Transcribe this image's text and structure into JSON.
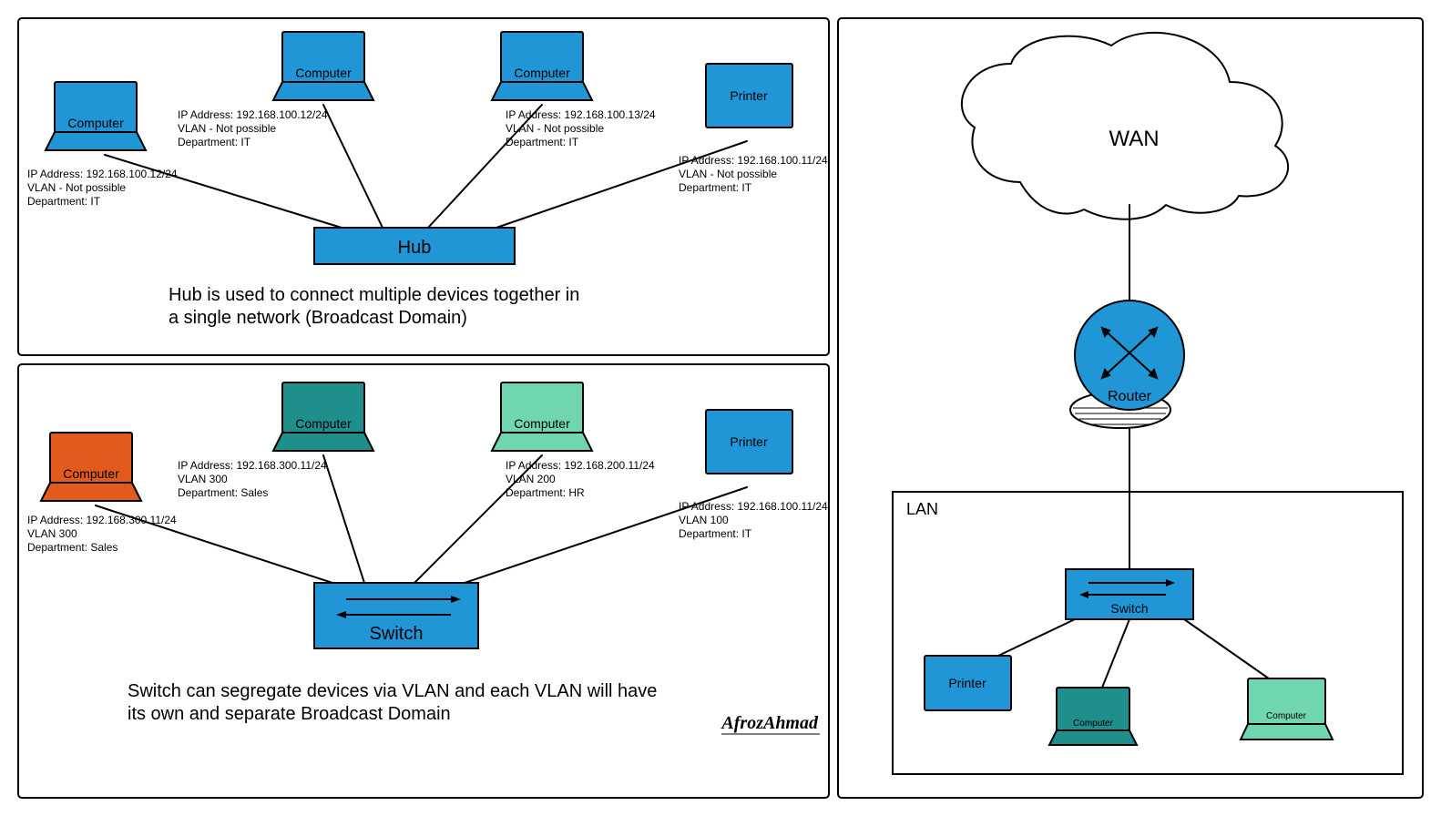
{
  "author": "AfrozAhmad",
  "colors": {
    "blue": "#2196d6",
    "teal": "#1f8f8c",
    "mint": "#6fd6b0",
    "orange": "#e35b1c"
  },
  "panel1": {
    "hub_label": "Hub",
    "caption_line1": "Hub is used to connect multiple devices together in",
    "caption_line2": "a single network (Broadcast Domain)",
    "nodes": [
      {
        "kind": "computer",
        "label": "Computer",
        "ip": "IP Address: 192.168.100.12/24",
        "vlan": "VLAN - Not possible",
        "dept": "Department: IT"
      },
      {
        "kind": "computer",
        "label": "Computer",
        "ip": "IP Address: 192.168.100.12/24",
        "vlan": "VLAN - Not possible",
        "dept": "Department: IT"
      },
      {
        "kind": "computer",
        "label": "Computer",
        "ip": "IP Address: 192.168.100.13/24",
        "vlan": "VLAN - Not possible",
        "dept": "Department: IT"
      },
      {
        "kind": "printer",
        "label": "Printer",
        "ip": "IP Address: 192.168.100.11/24",
        "vlan": "VLAN - Not possible",
        "dept": "Department: IT"
      }
    ]
  },
  "panel2": {
    "switch_label": "Switch",
    "caption_line1": "Switch can segregate devices via VLAN and each VLAN will have",
    "caption_line2": "its own and separate Broadcast Domain",
    "nodes": [
      {
        "kind": "computer",
        "label": "Computer",
        "ip": "IP Address: 192.168.300.11/24",
        "vlan": "VLAN 300",
        "dept": "Department: Sales"
      },
      {
        "kind": "computer",
        "label": "Computer",
        "ip": "IP Address: 192.168.300.11/24",
        "vlan": "VLAN 300",
        "dept": "Department: Sales"
      },
      {
        "kind": "computer",
        "label": "Computer",
        "ip": "IP Address: 192.168.200.11/24",
        "vlan": "VLAN 200",
        "dept": "Department: HR"
      },
      {
        "kind": "printer",
        "label": "Printer",
        "ip": "IP Address: 192.168.100.11/24",
        "vlan": "VLAN 100",
        "dept": "Department: IT"
      }
    ]
  },
  "panel3": {
    "wan_label": "WAN",
    "router_label": "Router",
    "lan_label": "LAN",
    "switch_label": "Switch",
    "printer_label": "Printer",
    "computer_label": "Computer"
  }
}
